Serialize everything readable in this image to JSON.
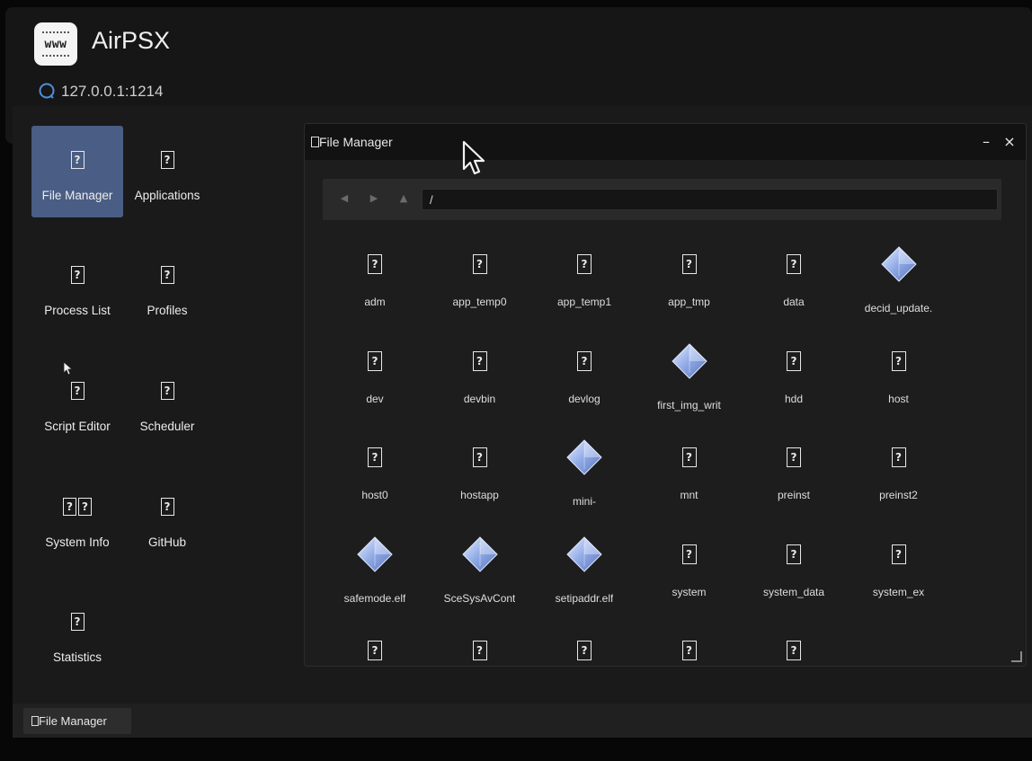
{
  "app": {
    "logo_text": "www",
    "title": "AirPSX",
    "server_address": "127.0.0.1:1214"
  },
  "sidebar": {
    "items": [
      {
        "label": "File Manager",
        "icon": "file-manager-icon",
        "active": true
      },
      {
        "label": "Applications",
        "icon": "applications-icon",
        "active": false
      },
      {
        "label": "Process List",
        "icon": "process-list-icon",
        "active": false
      },
      {
        "label": "Profiles",
        "icon": "profiles-icon",
        "active": false
      },
      {
        "label": "Script Editor",
        "icon": "script-editor-icon",
        "active": false
      },
      {
        "label": "Scheduler",
        "icon": "scheduler-icon",
        "active": false
      },
      {
        "label": "System Info",
        "icon": "system-info-icon",
        "active": false
      },
      {
        "label": "GitHub",
        "icon": "github-icon",
        "active": false
      },
      {
        "label": "Statistics",
        "icon": "statistics-icon",
        "active": false
      }
    ]
  },
  "file_manager": {
    "title": "File Manager",
    "minimize": "–",
    "close": "×",
    "back": "◀",
    "forward": "▶",
    "up": "▲",
    "path": "/",
    "files": [
      {
        "name": "adm",
        "type": "folder"
      },
      {
        "name": "app_temp0",
        "type": "folder"
      },
      {
        "name": "app_temp1",
        "type": "folder"
      },
      {
        "name": "app_tmp",
        "type": "folder"
      },
      {
        "name": "data",
        "type": "folder"
      },
      {
        "name": "decid_update.",
        "type": "file"
      },
      {
        "name": "dev",
        "type": "folder"
      },
      {
        "name": "devbin",
        "type": "folder"
      },
      {
        "name": "devlog",
        "type": "folder"
      },
      {
        "name": "first_img_writ",
        "type": "file"
      },
      {
        "name": "hdd",
        "type": "folder"
      },
      {
        "name": "host",
        "type": "folder"
      },
      {
        "name": "host0",
        "type": "folder"
      },
      {
        "name": "hostapp",
        "type": "folder"
      },
      {
        "name": "mini-",
        "type": "file"
      },
      {
        "name": "mnt",
        "type": "folder"
      },
      {
        "name": "preinst",
        "type": "folder"
      },
      {
        "name": "preinst2",
        "type": "folder"
      },
      {
        "name": "safemode.elf",
        "type": "file"
      },
      {
        "name": "SceSysAvCont",
        "type": "file"
      },
      {
        "name": "setipaddr.elf",
        "type": "file"
      },
      {
        "name": "system",
        "type": "folder"
      },
      {
        "name": "system_data",
        "type": "folder"
      },
      {
        "name": "system_ex",
        "type": "folder"
      },
      {
        "name": "",
        "type": "folder"
      },
      {
        "name": "",
        "type": "folder"
      },
      {
        "name": "",
        "type": "folder"
      },
      {
        "name": "",
        "type": "folder"
      },
      {
        "name": "",
        "type": "folder"
      }
    ]
  },
  "taskbar": {
    "items": [
      {
        "label": "File Manager"
      }
    ]
  },
  "colors": {
    "active_nav": "#4a5d84",
    "window_bg": "#1d1d1d",
    "accent_gem": "#8fa9e6"
  }
}
